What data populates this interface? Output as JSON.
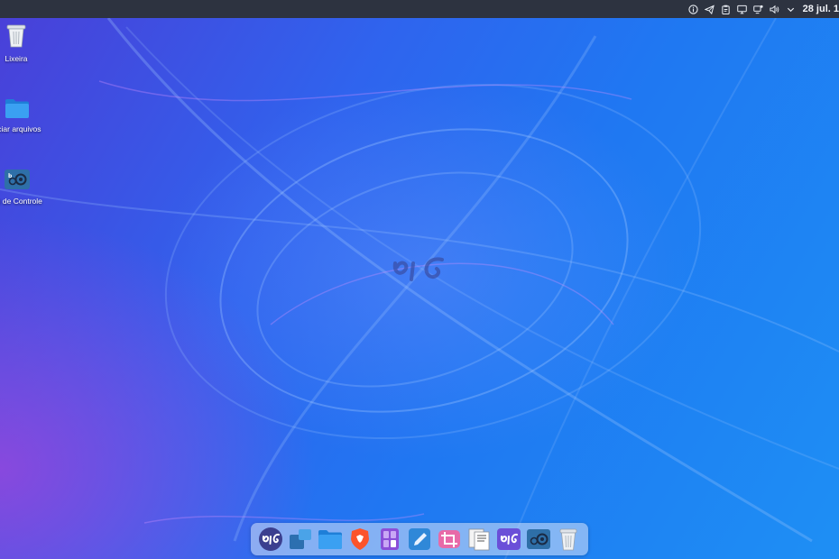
{
  "top_panel": {
    "tray_icons": [
      "info-icon",
      "telegram-icon",
      "clipboard-icon",
      "display-icon",
      "network-icon",
      "volume-icon",
      "expand-tray-icon"
    ],
    "clock": "28 jul. 1"
  },
  "desktop": {
    "icons": [
      {
        "label": "Lixeira",
        "icon": "trash-icon"
      },
      {
        "label": "nciar arquivos",
        "icon": "folder-icon"
      },
      {
        "label": "ral de Controle",
        "icon": "control-center-icon"
      }
    ],
    "wallpaper_logo": "BIG"
  },
  "dock": {
    "items": [
      "biglinux-menu",
      "workspaces",
      "file-manager",
      "brave-browser",
      "calculator",
      "text-editor",
      "screenshot-tool",
      "document-viewer",
      "biglinux-app",
      "control-center",
      "trash"
    ]
  },
  "colors": {
    "panel": "#2d3340",
    "wallpaper_blue": "#1f78f2",
    "wallpaper_purple": "#8a45d8"
  }
}
